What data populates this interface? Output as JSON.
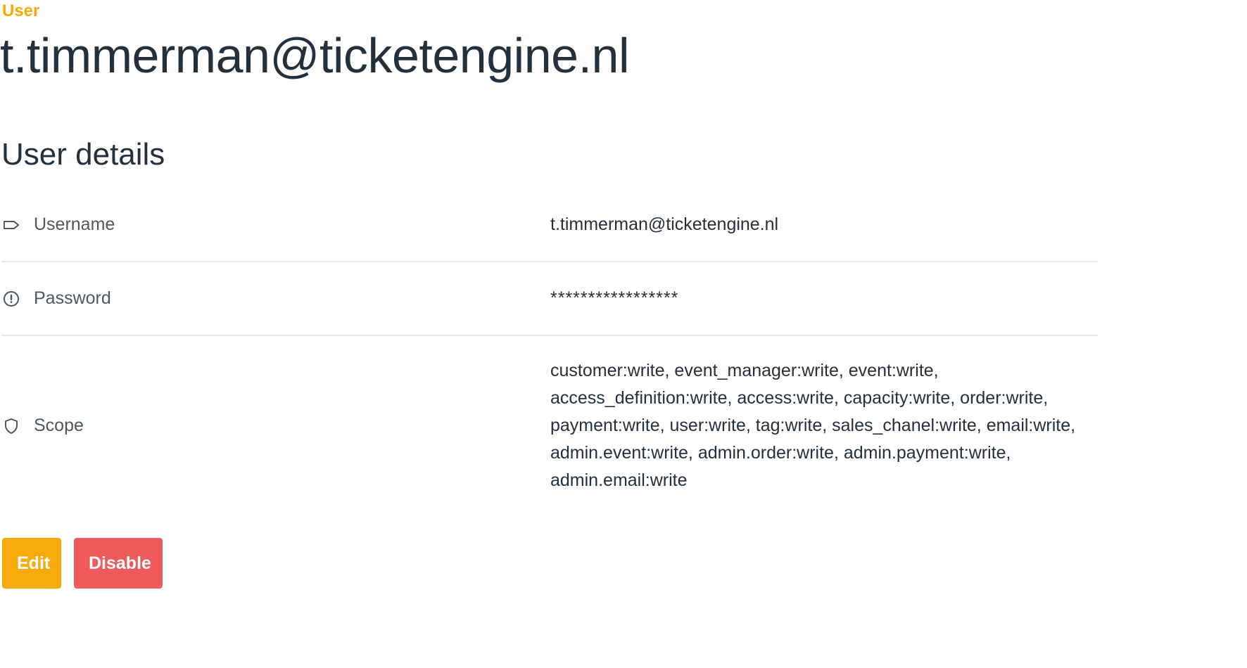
{
  "header": {
    "section_label": "User",
    "title": "t.timmerman@ticketengine.nl"
  },
  "details": {
    "title": "User details",
    "rows": [
      {
        "icon": "tag-icon",
        "label": "Username",
        "value": "t.timmerman@ticketengine.nl"
      },
      {
        "icon": "info-circle-icon",
        "label": "Password",
        "value": "*****************"
      },
      {
        "icon": "shield-icon",
        "label": "Scope",
        "value": "customer:write, event_manager:write, event:write, access_definition:write, access:write, capacity:write, order:write, payment:write, user:write, tag:write, sales_chanel:write, email:write, admin.event:write, admin.order:write, admin.payment:write, admin.email:write"
      }
    ]
  },
  "actions": {
    "edit_label": "Edit",
    "disable_label": "Disable"
  },
  "colors": {
    "accent": "#f7ab0a",
    "danger": "#ef5a5d",
    "text": "#22313f",
    "label": "#4b5763",
    "divider": "#e3e6e8"
  }
}
